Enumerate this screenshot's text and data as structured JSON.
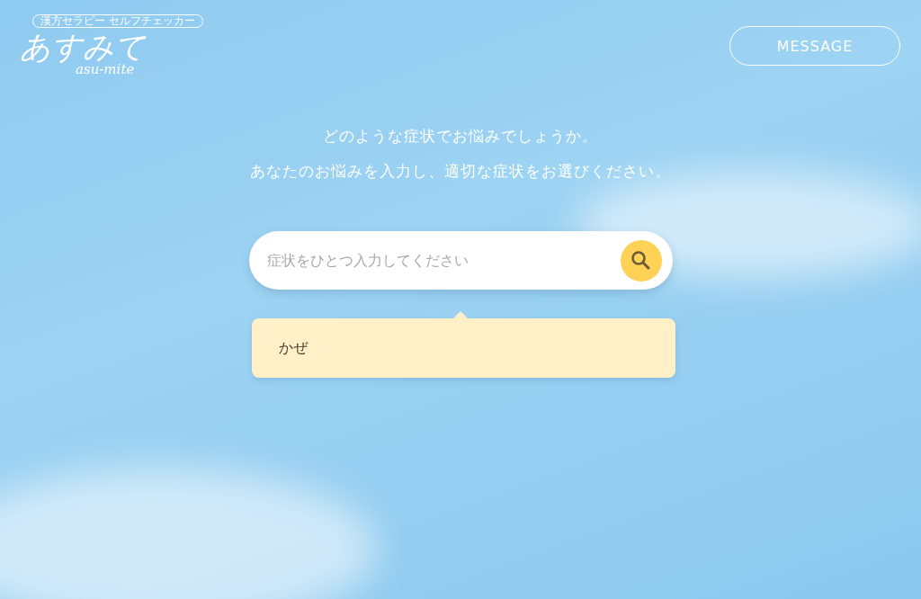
{
  "logo": {
    "tagline": "漢方セラピー セルフチェッカー",
    "title": "あすみて",
    "subtitle": "asu-mite"
  },
  "header": {
    "button": "MESSAGE"
  },
  "prompt": [
    "どのような症状でお悩みでしょうか。",
    "あなたのお悩みを入力し、適切な症状をお選びください。"
  ],
  "search": {
    "placeholder": "症状をひとつ入力してください"
  },
  "suggestions": [
    {
      "label": "かぜ"
    }
  ]
}
